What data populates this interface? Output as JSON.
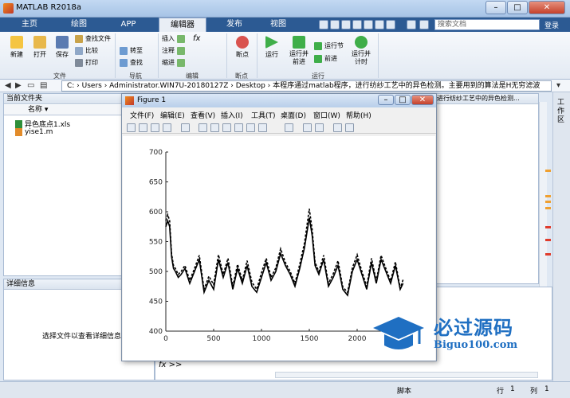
{
  "window": {
    "title": "MATLAB R2018a",
    "min": "–",
    "max": "□",
    "close": "✕"
  },
  "tabs": [
    "主页",
    "绘图",
    "APP",
    "编辑器",
    "发布",
    "视图"
  ],
  "search": {
    "placeholder": "搜索文档",
    "login": "登录"
  },
  "ribbon": {
    "file": {
      "new": "新建",
      "open": "打开",
      "save": "保存",
      "find_files": "查找文件",
      "compare": "比较",
      "print": "打印",
      "group": "文件"
    },
    "nav": {
      "goto": "转至",
      "find": "查找",
      "group": "导航"
    },
    "edit": {
      "insert": "插入",
      "comment": "注释",
      "indent": "缩进",
      "fx": "fx",
      "group": "编辑"
    },
    "breakpoints": {
      "label": "断点",
      "group": "断点"
    },
    "run": {
      "run": "运行",
      "run_adv": "运行并\n前进",
      "run_section": "运行节",
      "advance": "前进",
      "run_time": "运行并\n计时",
      "group": "运行"
    }
  },
  "path": {
    "segments": "C: › Users › Administrator.WIN7U-20180127Z › Desktop › 本程序通过matlab程序，进行纺纱工艺中的异色检测。主要用到的算法是H无穷滤波"
  },
  "current_folder": {
    "title": "当前文件夹",
    "column": "名称 ▾",
    "files": [
      "异色底点1.xls",
      "yise1.m"
    ]
  },
  "details": {
    "title": "详细信息",
    "hint": "选择文件以查看详细信息"
  },
  "editor_tab": "进行纺纱工艺中的异色检测...",
  "workspace_label": "工作区",
  "prompt": "fx >>",
  "statusbar": {
    "mode": "脚本",
    "row_label": "行",
    "row": "1",
    "col_label": "列",
    "col": "1"
  },
  "figure": {
    "title": "Figure 1",
    "menu": [
      "文件(F)",
      "编辑(E)",
      "查看(V)",
      "插入(I)",
      "工具(T)",
      "桌面(D)",
      "窗口(W)",
      "帮助(H)"
    ]
  },
  "watermark": {
    "brand": "必过源码",
    "url": "Biguo100.com"
  },
  "chart_data": {
    "type": "line",
    "title": "",
    "xlabel": "",
    "ylabel": "",
    "xlim": [
      0,
      2500
    ],
    "ylim": [
      400,
      700
    ],
    "xticks": [
      0,
      500,
      1000,
      1500,
      2000
    ],
    "yticks": [
      400,
      450,
      500,
      550,
      600,
      650,
      700
    ],
    "series": [
      {
        "style": "solid",
        "color": "#000000",
        "x": [
          0,
          20,
          40,
          60,
          80,
          100,
          130,
          160,
          200,
          250,
          300,
          350,
          400,
          450,
          500,
          550,
          600,
          650,
          700,
          750,
          800,
          850,
          900,
          950,
          1000,
          1050,
          1100,
          1150,
          1200,
          1250,
          1300,
          1350,
          1400,
          1450,
          1500,
          1530,
          1560,
          1600,
          1650,
          1700,
          1750,
          1800,
          1850,
          1900,
          1950,
          2000,
          2050,
          2100,
          2150,
          2200,
          2250,
          2300,
          2350,
          2400,
          2450,
          2480
        ],
        "y": [
          575,
          585,
          575,
          525,
          505,
          500,
          490,
          495,
          505,
          480,
          500,
          520,
          465,
          485,
          470,
          520,
          490,
          515,
          470,
          505,
          480,
          510,
          475,
          465,
          490,
          515,
          485,
          500,
          530,
          510,
          495,
          475,
          505,
          540,
          590,
          560,
          510,
          495,
          520,
          475,
          490,
          510,
          470,
          460,
          500,
          520,
          495,
          470,
          515,
          480,
          520,
          500,
          480,
          510,
          470,
          480
        ]
      },
      {
        "style": "dashed",
        "color": "#000000",
        "x": [
          0,
          20,
          40,
          60,
          80,
          100,
          130,
          160,
          200,
          250,
          300,
          350,
          400,
          450,
          500,
          550,
          600,
          650,
          700,
          750,
          800,
          850,
          900,
          950,
          1000,
          1050,
          1100,
          1150,
          1200,
          1250,
          1300,
          1350,
          1400,
          1450,
          1500,
          1530,
          1560,
          1600,
          1650,
          1700,
          1750,
          1800,
          1850,
          1900,
          1950,
          2000,
          2050,
          2100,
          2150,
          2200,
          2250,
          2300,
          2350,
          2400,
          2450,
          2480
        ],
        "y": [
          585,
          595,
          585,
          530,
          510,
          505,
          495,
          500,
          510,
          485,
          505,
          527,
          470,
          492,
          478,
          528,
          495,
          522,
          475,
          512,
          485,
          518,
          482,
          470,
          498,
          522,
          490,
          506,
          538,
          515,
          500,
          480,
          512,
          548,
          605,
          570,
          515,
          500,
          527,
          480,
          496,
          518,
          474,
          465,
          506,
          528,
          500,
          475,
          522,
          484,
          527,
          505,
          484,
          516,
          472,
          486
        ]
      }
    ]
  }
}
